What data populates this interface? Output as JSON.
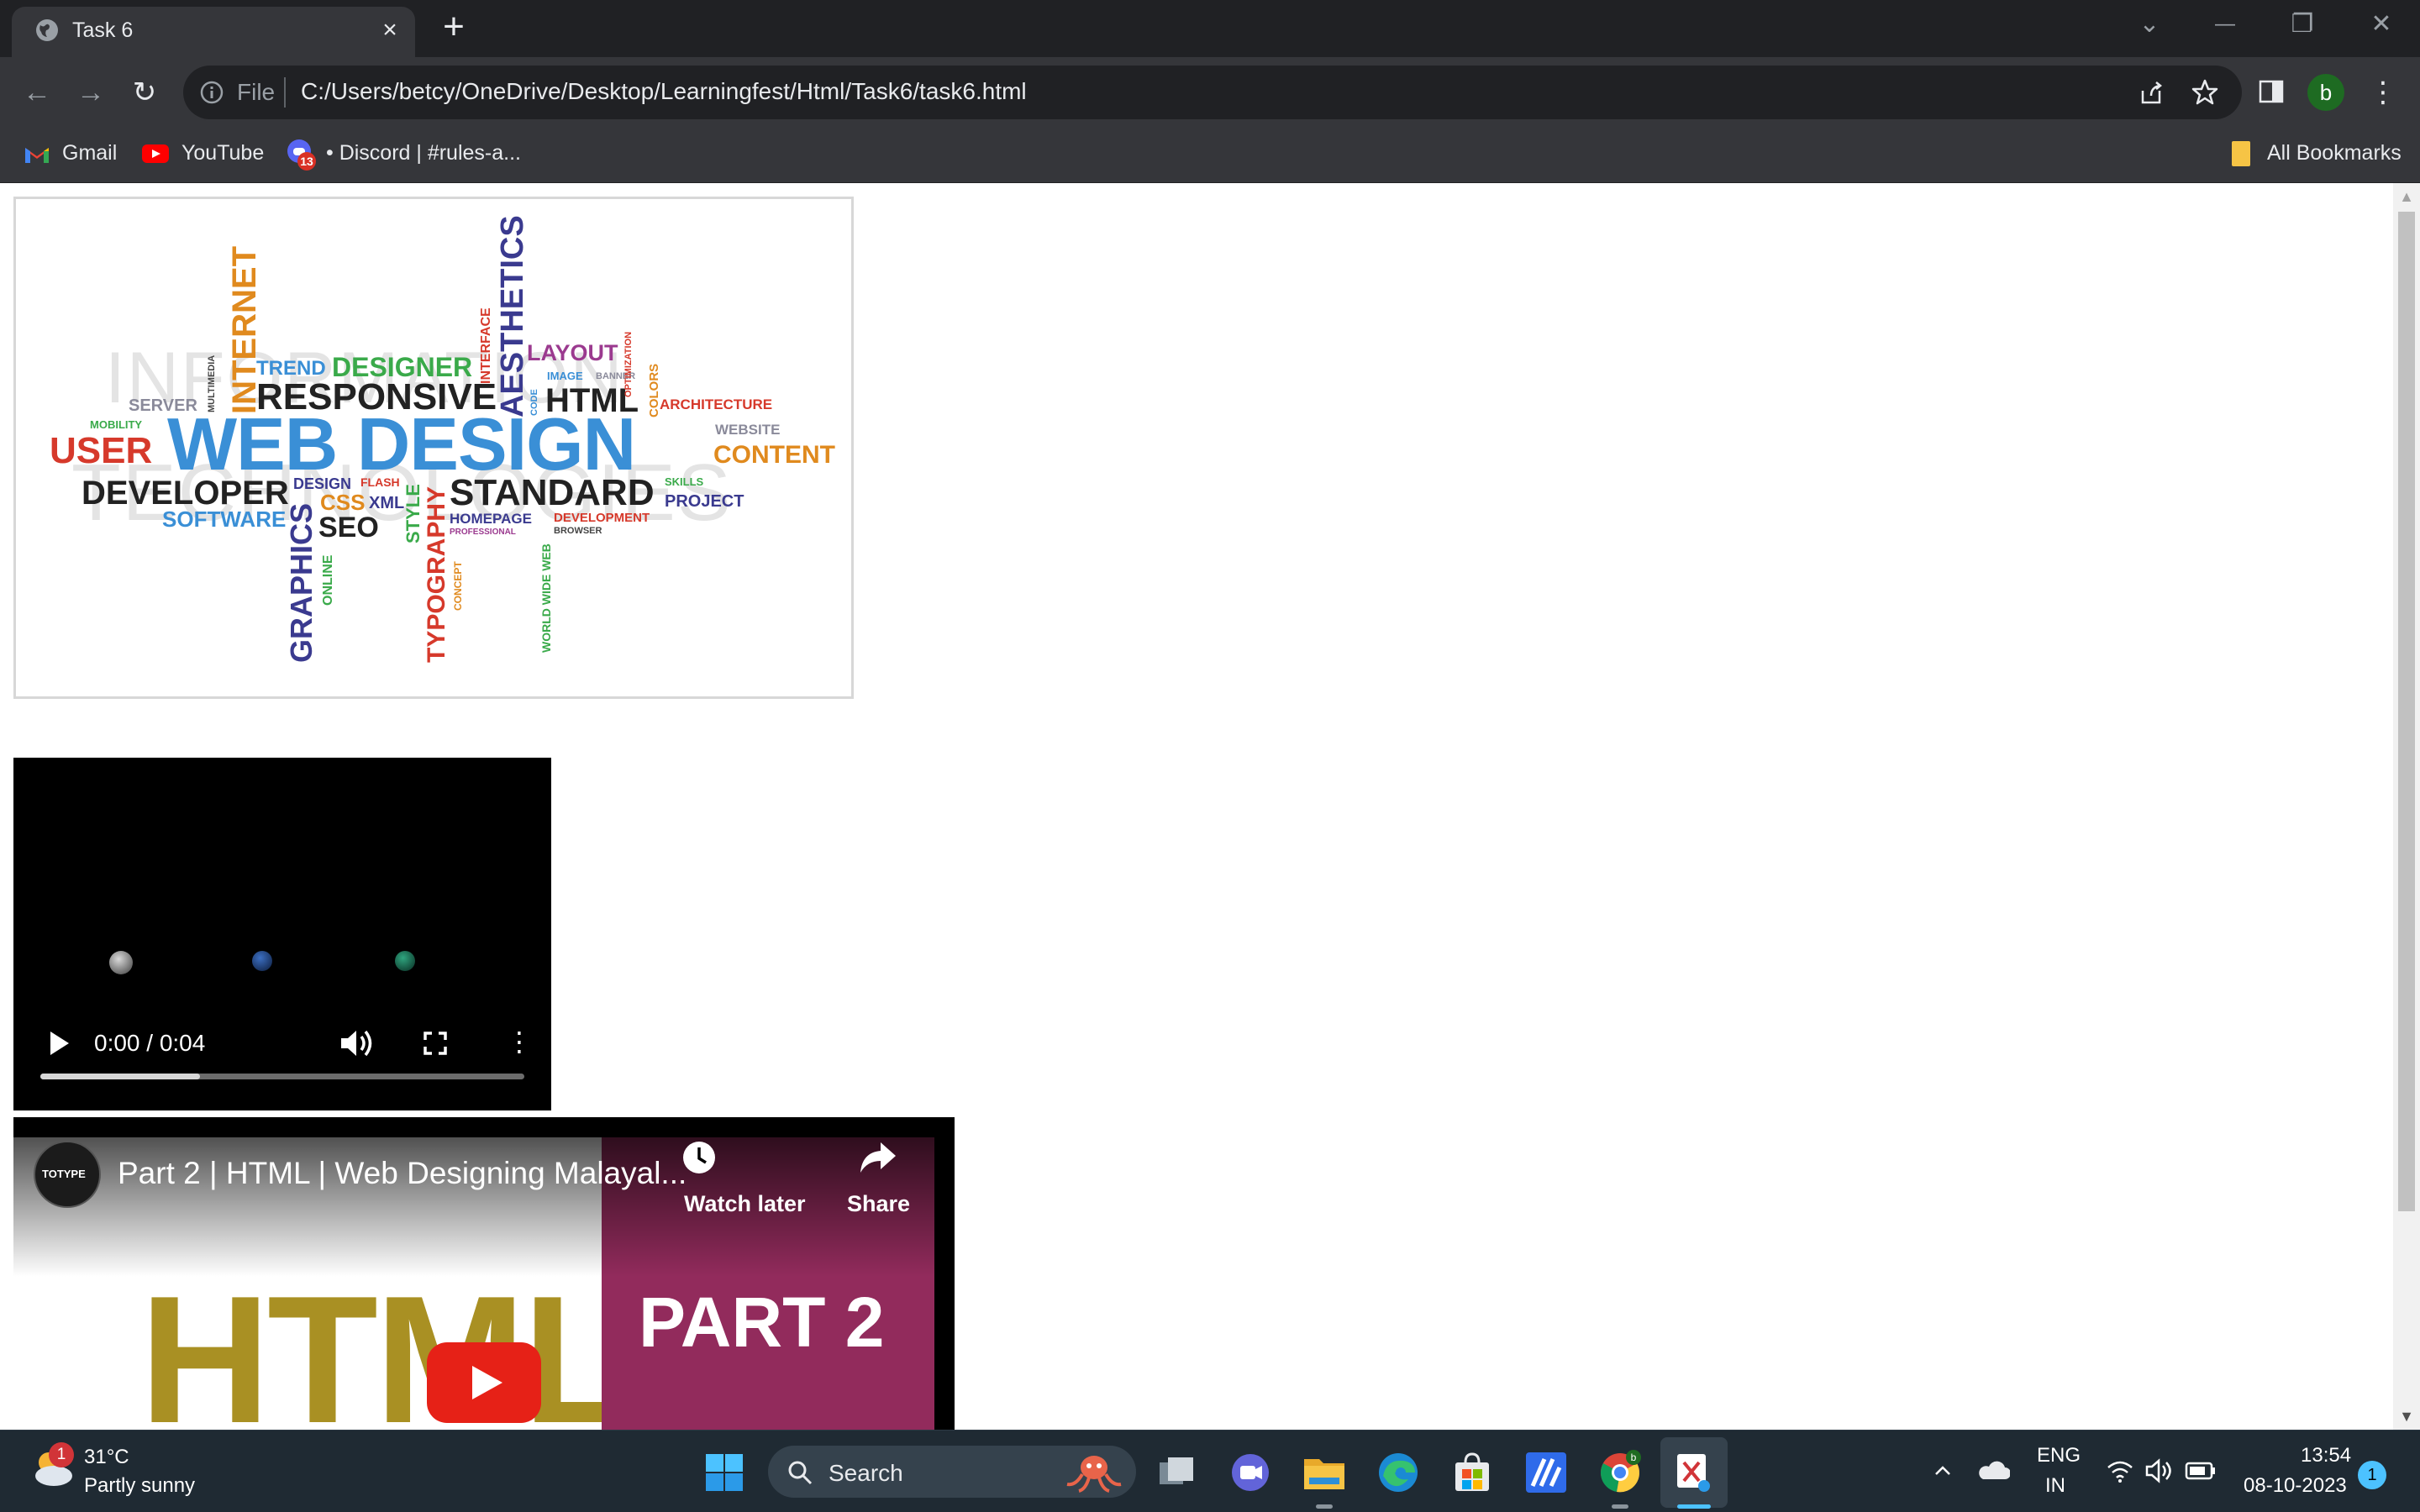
{
  "browser": {
    "tab_title": "Task 6",
    "tab_close": "×",
    "new_tab": "+",
    "window_controls": {
      "tab_search": "⌄",
      "minimize": "—",
      "restore": "❐",
      "close": "✕"
    },
    "omnibox": {
      "scheme_label": "File",
      "url": "C:/Users/betcy/OneDrive/Desktop/Learningfest/Html/Task6/task6.html"
    },
    "nav": {
      "back": "←",
      "forward": "→",
      "reload": "↻"
    },
    "profile_initial": "b",
    "menu_dots": "⋮",
    "bookmarks": [
      {
        "label": "Gmail",
        "icon": "gmail-icon"
      },
      {
        "label": "YouTube",
        "icon": "youtube-icon"
      },
      {
        "label": "• Discord | #rules-a...",
        "icon": "discord-icon",
        "badge": "13"
      }
    ],
    "all_bookmarks": "All Bookmarks"
  },
  "page": {
    "wordcloud": {
      "alt": "Web design word cloud",
      "background_words": [
        "INFORMATION",
        "TECHNOLOGIES"
      ],
      "words": [
        {
          "text": "WEB DESIGN",
          "color": "#3a8fd6"
        },
        {
          "text": "RESPONSIVE",
          "color": "#222222"
        },
        {
          "text": "DEVELOPER",
          "color": "#222222"
        },
        {
          "text": "STANDARD",
          "color": "#222222"
        },
        {
          "text": "USER",
          "color": "#d6392b"
        },
        {
          "text": "CONTENT",
          "color": "#e08a1e"
        },
        {
          "text": "HTML",
          "color": "#222222"
        },
        {
          "text": "DESIGNER",
          "color": "#3aaa4a"
        },
        {
          "text": "TREND",
          "color": "#3a8fd6"
        },
        {
          "text": "LAYOUT",
          "color": "#9b3a8f"
        },
        {
          "text": "SERVER",
          "color": "#8a8a9a"
        },
        {
          "text": "SOFTWARE",
          "color": "#3a8fd6"
        },
        {
          "text": "SEO",
          "color": "#222222"
        },
        {
          "text": "CSS",
          "color": "#e08a1e"
        },
        {
          "text": "XML",
          "color": "#3a3a8f"
        },
        {
          "text": "DESIGN",
          "color": "#3a3a8f"
        },
        {
          "text": "FLASH",
          "color": "#d6392b"
        },
        {
          "text": "PROJECT",
          "color": "#3a3a8f"
        },
        {
          "text": "ARCHITECTURE",
          "color": "#d6392b"
        },
        {
          "text": "WEBSITE",
          "color": "#8a8a9a"
        },
        {
          "text": "HOMEPAGE",
          "color": "#3a3a8f"
        },
        {
          "text": "DEVELOPMENT",
          "color": "#d6392b"
        },
        {
          "text": "MOBILITY",
          "color": "#3aaa4a"
        },
        {
          "text": "IMAGE",
          "color": "#3a8fd6"
        },
        {
          "text": "BANNER",
          "color": "#8a8a9a"
        },
        {
          "text": "SKILLS",
          "color": "#3aaa4a"
        },
        {
          "text": "BROWSER",
          "color": "#444444"
        },
        {
          "text": "PROFESSIONAL",
          "color": "#9b3a8f"
        },
        {
          "text": "INTERNET",
          "color": "#e08a1e"
        },
        {
          "text": "AESTHETICS",
          "color": "#3a3a8f"
        },
        {
          "text": "GRAPHICS",
          "color": "#3a3a8f"
        },
        {
          "text": "TYPOGRAPHY",
          "color": "#d6392b"
        },
        {
          "text": "STYLE",
          "color": "#3aaa4a"
        },
        {
          "text": "INTERFACE",
          "color": "#d6392b"
        },
        {
          "text": "ONLINE",
          "color": "#3aaa4a"
        },
        {
          "text": "WORLD WIDE WEB",
          "color": "#3aaa4a"
        },
        {
          "text": "COLORS",
          "color": "#e08a1e"
        },
        {
          "text": "OPTIMIZATION",
          "color": "#d6392b"
        },
        {
          "text": "MULTIMEDIA",
          "color": "#444444"
        },
        {
          "text": "CODE",
          "color": "#3a8fd6"
        },
        {
          "text": "CONCEPT",
          "color": "#e08a1e"
        }
      ]
    },
    "video": {
      "time": "0:00 / 0:04",
      "progress_buffered_fraction": 0.33,
      "play_icon": "▶",
      "more_icon": "⋮"
    },
    "youtube": {
      "title": "Part 2 | HTML | Web Designing Malayal...",
      "channel_logo_text": "TOTYPE",
      "watch_later": "Watch later",
      "share": "Share",
      "thumb_left_text": "HTML",
      "thumb_right_text": "PART 2",
      "colors": {
        "html_gold": "#a99023",
        "part_magenta": "#922b5c",
        "play_red": "#e62117"
      }
    }
  },
  "taskbar": {
    "weather_temp": "31°C",
    "weather_desc": "Partly sunny",
    "weather_badge": "1",
    "search_label": "Search",
    "chrome_badge": "b",
    "lang_line1": "ENG",
    "lang_line2": "IN",
    "time": "13:54",
    "date": "08-10-2023",
    "notification_count": "1",
    "tray_up": "^"
  }
}
